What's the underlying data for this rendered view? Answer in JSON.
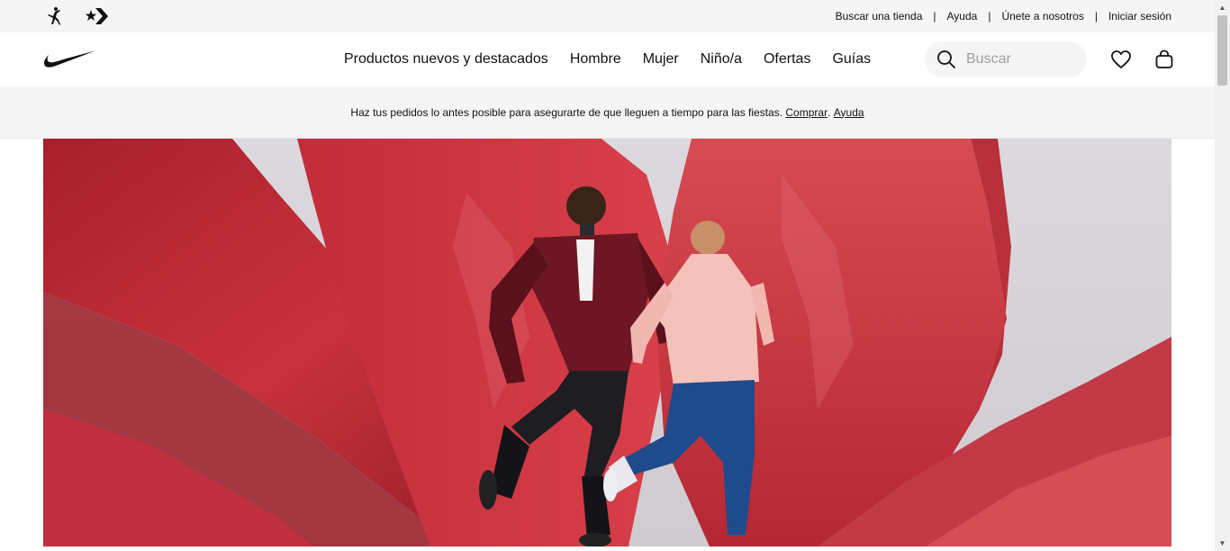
{
  "utility_bar": {
    "links": [
      {
        "label": "Buscar una tienda"
      },
      {
        "label": "Ayuda"
      },
      {
        "label": "Únete a nosotros"
      },
      {
        "label": "Iniciar sesión"
      }
    ],
    "separator": "|",
    "brand_icons": [
      "jordan-jumpman-icon",
      "converse-star-chevron-icon"
    ]
  },
  "main_nav": {
    "logo_icon": "nike-swoosh-icon",
    "menu": [
      {
        "label": "Productos nuevos y destacados"
      },
      {
        "label": "Hombre"
      },
      {
        "label": "Mujer"
      },
      {
        "label": "Niño/a"
      },
      {
        "label": "Ofertas"
      },
      {
        "label": "Guías"
      }
    ],
    "search": {
      "placeholder": "Buscar",
      "value": ""
    },
    "actions": [
      "heart-icon",
      "bag-icon"
    ]
  },
  "promo": {
    "text": "Haz tus pedidos lo antes posible para asegurarte de que lleguen a tiempo para las fiestas.",
    "link_shop": "Comprar",
    "period": ".",
    "link_help": "Ayuda"
  },
  "hero": {
    "image": "two runners in front of red crumpled paper backdrop"
  },
  "colors": {
    "text": "#111111",
    "bar_bg": "#f5f5f5",
    "hero_red": "#c8323c",
    "hero_bg": "#d9d6db"
  }
}
